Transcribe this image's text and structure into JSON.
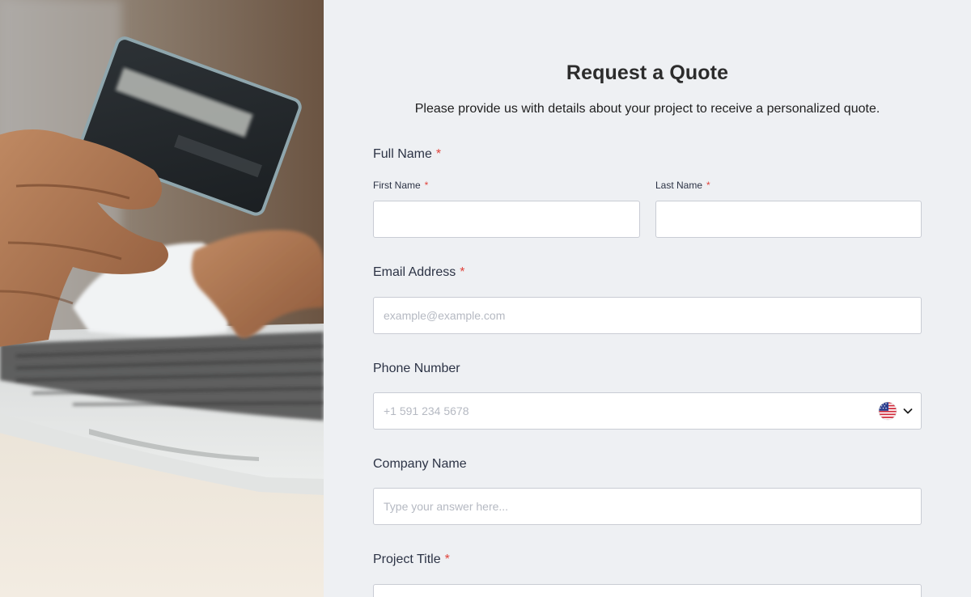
{
  "form": {
    "title": "Request a Quote",
    "subtitle": "Please provide us with details about your project to receive a personalized quote.",
    "required_mark": "*",
    "full_name": {
      "label": "Full Name",
      "first_name_label": "First Name",
      "first_name_value": "",
      "last_name_label": "Last Name",
      "last_name_value": ""
    },
    "email": {
      "label": "Email Address",
      "placeholder": "example@example.com",
      "value": ""
    },
    "phone": {
      "label": "Phone Number",
      "placeholder": "+1 591 234 5678",
      "value": "",
      "country_icon": "us-flag-icon",
      "dropdown_icon": "chevron-down-icon"
    },
    "company": {
      "label": "Company Name",
      "placeholder": "Type your answer here...",
      "value": ""
    },
    "project_title": {
      "label": "Project Title",
      "value": ""
    }
  },
  "colors": {
    "panel_background": "#eef0f3",
    "required": "#e0433b",
    "label_text": "#2c3345",
    "input_border": "#c9ccd4"
  }
}
